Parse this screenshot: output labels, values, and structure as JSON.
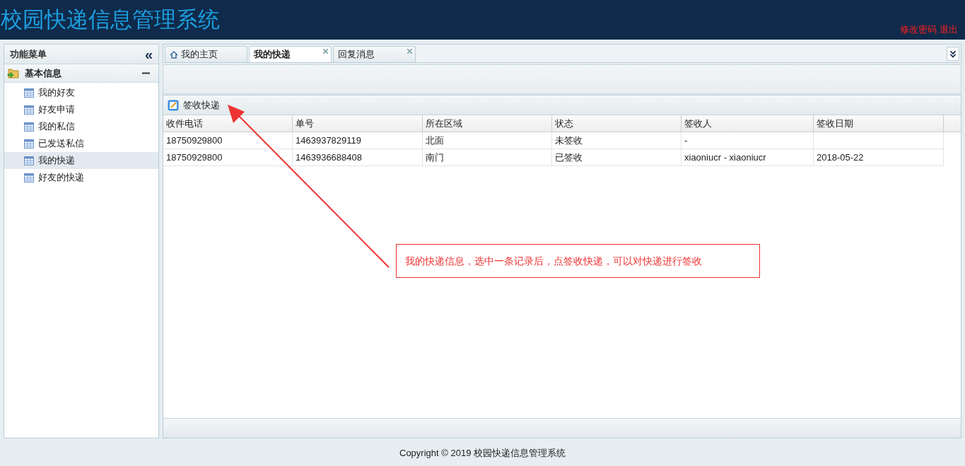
{
  "header": {
    "title": "校园快递信息管理系统",
    "links": [
      "修改密码",
      "退出"
    ]
  },
  "sidebar": {
    "title": "功能菜单",
    "collapse": "«",
    "group": {
      "label": "基本信息",
      "expanded": true,
      "items": [
        {
          "label": "我的好友",
          "selected": false
        },
        {
          "label": "好友申请",
          "selected": false
        },
        {
          "label": "我的私信",
          "selected": false
        },
        {
          "label": "已发送私信",
          "selected": false
        },
        {
          "label": "我的快递",
          "selected": true
        },
        {
          "label": "好友的快递",
          "selected": false
        }
      ]
    }
  },
  "tabs": [
    {
      "label": "我的主页",
      "selected": false,
      "closable": false,
      "home": true
    },
    {
      "label": "我的快递",
      "selected": true,
      "closable": true,
      "home": false
    },
    {
      "label": "回复消息",
      "selected": false,
      "closable": true,
      "home": false
    }
  ],
  "toolbar": {
    "button": "签收快递"
  },
  "table": {
    "columns": [
      "收件电话",
      "单号",
      "所在区域",
      "状态",
      "签收人",
      "签收日期"
    ],
    "rows": [
      [
        "18750929800",
        "1463937829119",
        "北面",
        "未签收",
        "-",
        ""
      ],
      [
        "18750929800",
        "1463936688408",
        "南门",
        "已签收",
        "xiaoniucr - xiaoniucr",
        "2018-05-22"
      ]
    ]
  },
  "annotation": {
    "text": "我的快递信息，选中一条记录后，点签收快递，可以对快递进行签收"
  },
  "footer": "Copyright © 2019 校园快递信息管理系统"
}
